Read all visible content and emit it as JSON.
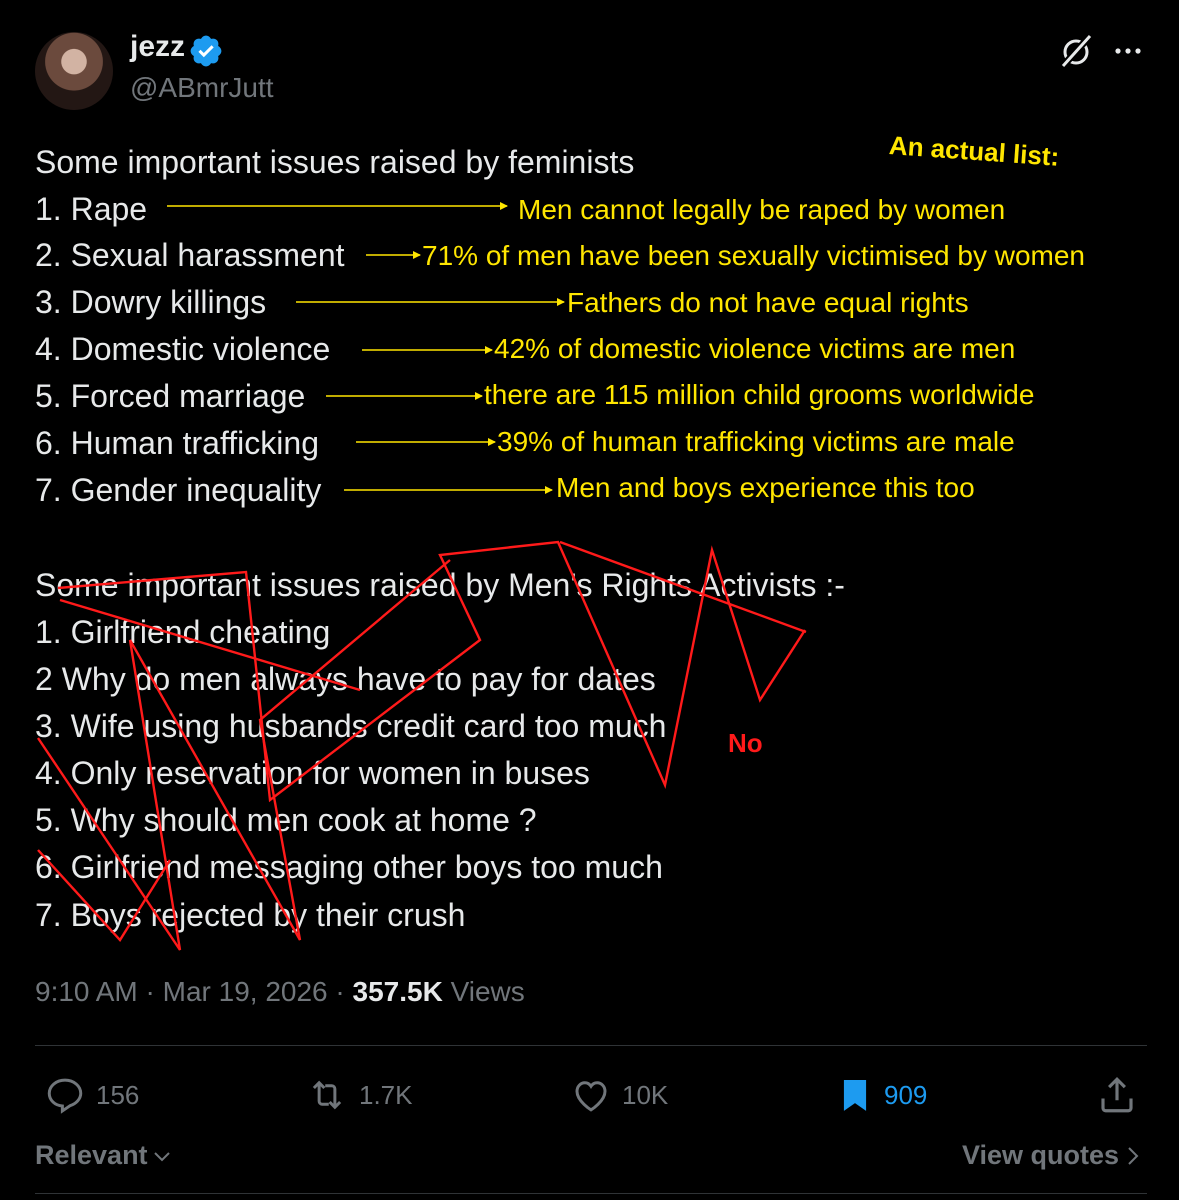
{
  "author": {
    "name": "jezz",
    "handle": "@ABmrJutt",
    "verified": true
  },
  "tweet": {
    "feminist_heading": "Some important issues raised by feminists",
    "feminist_items": [
      "1. Rape",
      "2. Sexual harassment",
      "3. Dowry killings",
      "4. Domestic violence",
      "5. Forced marriage",
      "6. Human trafficking",
      "7. Gender inequality"
    ],
    "mra_heading": "Some important issues raised by Men's Rights Activists :-",
    "mra_items": [
      "1. Girlfriend cheating",
      "2 Why do men always have to pay for dates",
      "3. Wife using husbands credit card too much",
      "4. Only reservation for women in buses",
      "5. Why should men cook at home ?",
      "6. Girlfriend messaging other boys too much",
      "7. Boys rejected by their crush"
    ]
  },
  "annotations": {
    "title": "An actual list:",
    "items": [
      "Men cannot legally be raped by women",
      "71% of men have been sexually victimised by women",
      "Fathers do not have equal rights",
      "42% of domestic violence victims are men",
      "there are 115 million child grooms worldwide",
      "39% of human trafficking victims are male",
      "Men and boys experience this too"
    ],
    "no_label": "No",
    "colors": {
      "annotation": "#ffe600",
      "strike": "#ff1a1a"
    }
  },
  "meta": {
    "time": "9:10 AM",
    "separator": "·",
    "date": "Mar 19, 2026",
    "views_count": "357.5K",
    "views_label": "Views"
  },
  "actions": {
    "replies": "156",
    "reposts": "1.7K",
    "likes": "10K",
    "bookmarks": "909"
  },
  "footer": {
    "sort_label": "Relevant",
    "view_quotes": "View quotes"
  },
  "colors": {
    "background": "#000000",
    "text": "#e7e9ea",
    "muted": "#71767b",
    "accent": "#1d9bf0"
  }
}
